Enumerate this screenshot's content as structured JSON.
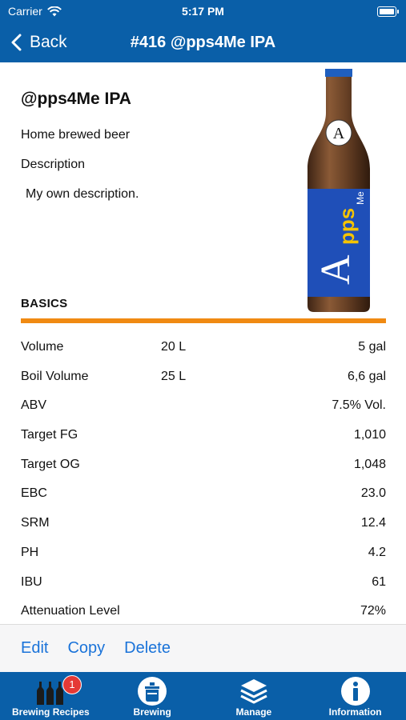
{
  "status_bar": {
    "carrier": "Carrier",
    "time": "5:17 PM"
  },
  "nav": {
    "back_label": "Back",
    "title": "#416 @pps4Me IPA"
  },
  "recipe": {
    "name": "@pps4Me IPA",
    "type": "Home brewed beer",
    "description_label": "Description",
    "description": "My own description.",
    "bottle_label_text": "Apps4Me"
  },
  "basics": {
    "title": "BASICS",
    "accent_color": "#f08a12",
    "rows": [
      {
        "label": "Volume",
        "mid": "20 L",
        "value": "5 gal"
      },
      {
        "label": "Boil Volume",
        "mid": "25 L",
        "value": "6,6 gal"
      },
      {
        "label": "ABV",
        "mid": "",
        "value": "7.5% Vol."
      },
      {
        "label": "Target FG",
        "mid": "",
        "value": "1,010"
      },
      {
        "label": "Target OG",
        "mid": "",
        "value": "1,048"
      },
      {
        "label": "EBC",
        "mid": "",
        "value": "23.0"
      },
      {
        "label": "SRM",
        "mid": "",
        "value": "12.4"
      },
      {
        "label": "PH",
        "mid": "",
        "value": "4.2"
      },
      {
        "label": "IBU",
        "mid": "",
        "value": "61"
      },
      {
        "label": "Attenuation Level",
        "mid": "",
        "value": "72%"
      }
    ]
  },
  "actions": {
    "edit": "Edit",
    "copy": "Copy",
    "delete": "Delete"
  },
  "tabs": [
    {
      "label": "Brewing Recipes",
      "icon": "bottles-icon",
      "badge": "1"
    },
    {
      "label": "Brewing",
      "icon": "brew-kettle-icon"
    },
    {
      "label": "Manage",
      "icon": "layers-icon"
    },
    {
      "label": "Information",
      "icon": "info-icon"
    }
  ],
  "colors": {
    "primary": "#0a5fa8",
    "link": "#1a73d9",
    "badge": "#e53935"
  }
}
